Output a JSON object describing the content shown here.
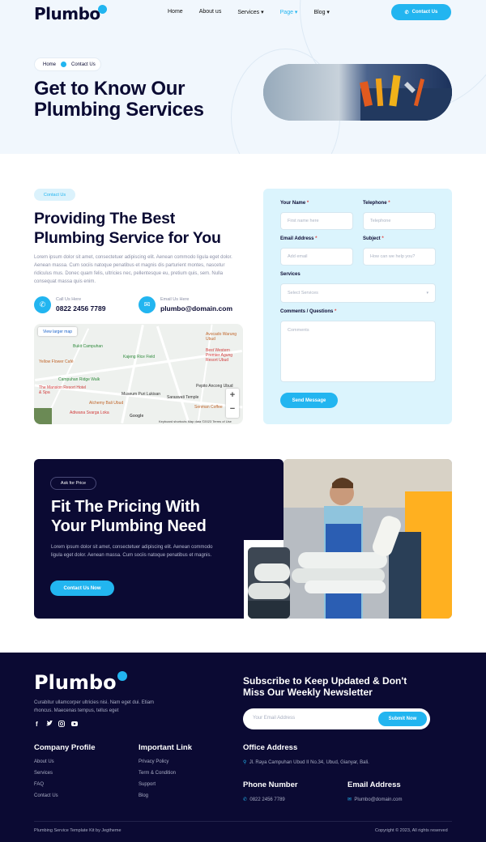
{
  "header": {
    "logo": "Plumbo",
    "nav": [
      {
        "label": "Home"
      },
      {
        "label": "About us"
      },
      {
        "label": "Services ▾"
      },
      {
        "label": "Page ▾"
      },
      {
        "label": "Blog ▾"
      }
    ],
    "contact_button": "Contact Us"
  },
  "hero": {
    "breadcrumb_home": "Home",
    "breadcrumb_current": "Contact Us",
    "title_line1": "Get to Know Our",
    "title_line2": "Plumbing Services"
  },
  "contact": {
    "tag": "Contact Us",
    "title_line1": "Providing The Best",
    "title_line2": "Plumbing Service for You",
    "paragraph": "Lorem ipsum dolor sit amet, consectetuer adipiscing elit. Aenean commodo ligula eget dolor. Aenean massa. Cum sociis natoque penatibus et magnis dis parturient montes, nascetur ridiculus mus. Donec quam felis, ultricies nec, pellentesque eu, pretium quis, sem. Nulla consequat massa quis enim.",
    "call_label": "Call Us Here",
    "call_value": "0822 2456 7789",
    "email_label": "Email Us Here",
    "email_value": "plumbo@domain.com",
    "map": {
      "view_larger": "View larger map",
      "places": [
        "Bukit Campuhan",
        "Kajeng Rice Field",
        "Avocado Warung Ubud",
        "Yellow Flower Café",
        "Campuhan Ridge Walk",
        "Best Western Premier Agung Resort Ubud",
        "The Mansion Resort Hotel & Spa",
        "Museum Puri Lukisan",
        "Pepito Ancong Ubud",
        "Alchemy Bali Ubud",
        "Saraswati Temple",
        "Adiwana Svarga Loka",
        "Senman Coffee"
      ],
      "footer_text": "Keyboard shortcuts   Map data ©2023   Terms of Use",
      "brand": "Google"
    }
  },
  "form": {
    "name_label": "Your Name",
    "name_placeholder": "First name here",
    "phone_label": "Telephone",
    "phone_placeholder": "Telephone",
    "email_label": "Email Address",
    "email_placeholder": "Add email",
    "subject_label": "Subject",
    "subject_placeholder": "How can we help you?",
    "services_label": "Services",
    "services_placeholder": "Select Services",
    "comments_label": "Comments / Questions",
    "comments_placeholder": "Comments",
    "submit": "Send Message",
    "required_mark": "*"
  },
  "pricing": {
    "tag": "Ask for Price",
    "title_line1": "Fit The Pricing With",
    "title_line2": "Your Plumbing Need",
    "paragraph": "Lorem ipsum dolor sit amet, consectetuer adipiscing elit. Aenean commodo ligula eget dolor. Aenean massa. Cum sociis natoque penatibus et magnis.",
    "button": "Contact Us Now"
  },
  "footer": {
    "logo": "Plumbo",
    "about": "Curabitur ullamcorper ultricies nisi. Nam eget dui. Etiam rhoncus. Maecenas tempus, tellus eget",
    "newsletter_title_line1": "Subscribe to Keep Updated & Don't",
    "newsletter_title_line2": "Miss Our Weekly Newsletter",
    "newsletter_placeholder": "Your Email Address",
    "newsletter_button": "Submit Now",
    "company_title": "Company Profile",
    "company_links": [
      "About Us",
      "Services",
      "FAQ",
      "Contact Us"
    ],
    "important_title": "Important Link",
    "important_links": [
      "Privacy Policy",
      "Term & Condition",
      "Support",
      "Blog"
    ],
    "office_title": "Office Address",
    "office_value": "Jl. Raya Campuhan Ubud II No.34, Ubud, Gianyar, Bali.",
    "phone_title": "Phone Number",
    "phone_value": "0822 2456 7789",
    "email_title": "Email Address",
    "email_value": "Plumbo@domain.com",
    "credit": "Plumbing Service Template Kit by Jegtheme",
    "copyright": "Copyright © 2023, All rights reserved"
  },
  "colors": {
    "accent": "#22b5f0",
    "navy": "#0b0a33",
    "hero_bg": "#f1f7fd",
    "form_bg": "#dbf4fd"
  }
}
